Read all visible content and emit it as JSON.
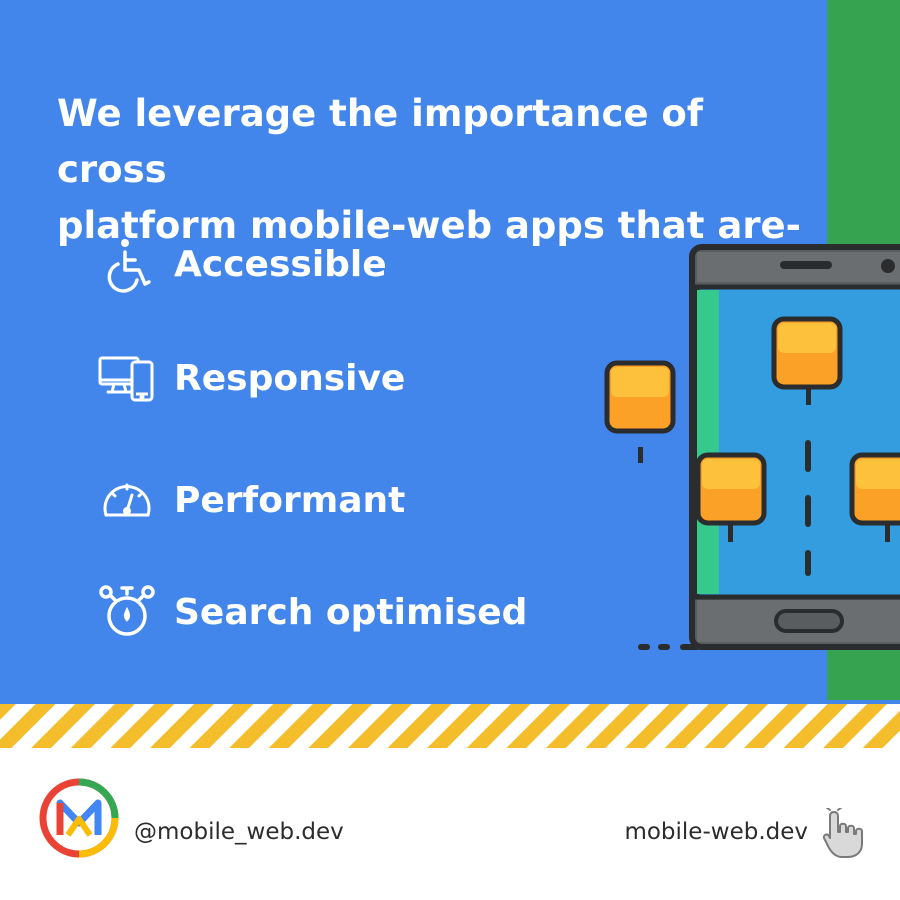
{
  "colors": {
    "background_blue": "#4386EB",
    "green_strip": "#35A34F",
    "hazard_yellow": "#F4BD2B",
    "text_white": "#FFFFFF",
    "footer_text": "#2C2C2C"
  },
  "headline": {
    "line1": "We leverage the importance of cross",
    "line2": "platform mobile-web apps that are-"
  },
  "features": [
    {
      "label": "Accessible",
      "icon": "wheelchair-icon"
    },
    {
      "label": "Responsive",
      "icon": "devices-icon"
    },
    {
      "label": "Performant",
      "icon": "speedometer-icon"
    },
    {
      "label": "Search optimised",
      "icon": "stopwatch-icon"
    }
  ],
  "illustration": {
    "icon": "smartphone-map-illustration"
  },
  "footer": {
    "logo_icon": "mobile-web-logo",
    "handle": "@mobile_web.dev",
    "website": "mobile-web.dev",
    "pointer_icon": "hand-pointer-icon"
  }
}
